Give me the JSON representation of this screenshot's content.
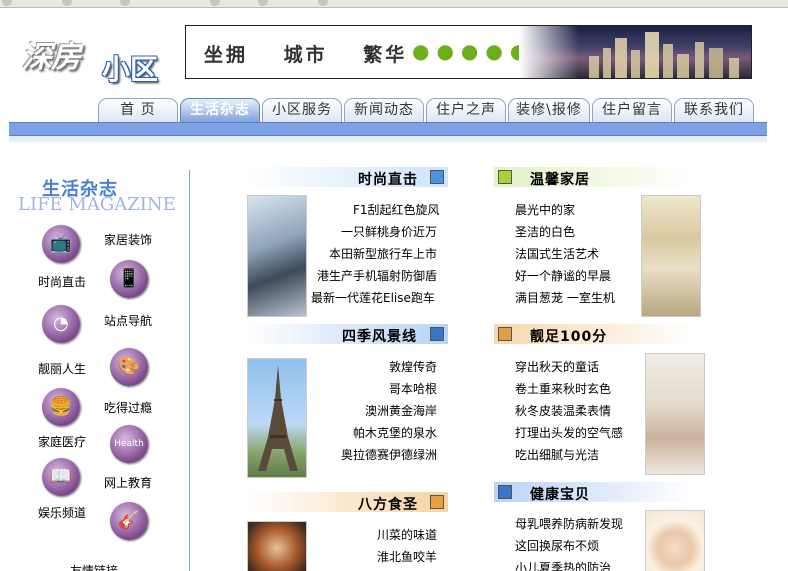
{
  "logo": {
    "part1": "深房",
    "part2": "小区"
  },
  "banner": {
    "slogan": [
      "坐拥",
      "城市",
      "繁华"
    ],
    "dots": "●●●●●"
  },
  "nav": {
    "tabs": [
      {
        "label": "首 页",
        "active": false
      },
      {
        "label": "生活杂志",
        "active": true
      },
      {
        "label": "小区服务",
        "active": false
      },
      {
        "label": "新闻动态",
        "active": false
      },
      {
        "label": "住户之声",
        "active": false
      },
      {
        "label": "装修\\报修",
        "active": false
      },
      {
        "label": "住户留言",
        "active": false
      },
      {
        "label": "联系我们",
        "active": false
      }
    ]
  },
  "sidebar": {
    "title": "生活杂志",
    "subtitle": "LIFE MAGAZINE",
    "items": [
      {
        "label": "家居装饰",
        "icon": "tv-icon"
      },
      {
        "label": "时尚直击",
        "icon": "mobile-phone-icon"
      },
      {
        "label": "站点导航",
        "icon": "clock-icon"
      },
      {
        "label": "靓丽人生",
        "icon": "palette-icon"
      },
      {
        "label": "吃得过瘾",
        "icon": "hamburger-icon"
      },
      {
        "label": "家庭医疗",
        "icon": "medicine-icon"
      },
      {
        "label": "网上教育",
        "icon": "book-icon"
      },
      {
        "label": "娱乐频道",
        "icon": "guitar-icon"
      }
    ],
    "bottom_label": "友情链接"
  },
  "sections": {
    "fashion": {
      "title": "时尚直击",
      "color": "#4b94e0",
      "items": [
        "F1刮起红色旋风",
        "一只鲜桃身价近万",
        "本田新型旅行车上市",
        "港生产手机辐射防御盾",
        "最新一代莲花Elise跑车"
      ]
    },
    "home": {
      "title": "温馨家居",
      "color": "#a6d23a",
      "items": [
        "晨光中的家",
        "圣洁的白色",
        "法国式生活艺术",
        "好一个静谧的早晨",
        "满目葱茏  一室生机"
      ]
    },
    "scenery": {
      "title": "四季风景线",
      "color": "#3a76c8",
      "items": [
        "敦煌传奇",
        "哥本哈根",
        "澳洲黄金海岸",
        "帕木克堡的泉水",
        "奥拉德赛伊德绿洲"
      ]
    },
    "beauty": {
      "title": "靓足100分",
      "color": "#e0a048",
      "items": [
        "穿出秋天的童话",
        "卷土重来秋时玄色",
        "秋冬皮装温柔表情",
        "打理出头发的空气感",
        "吃出细腻与光洁"
      ]
    },
    "food": {
      "title": "八方食圣",
      "color": "#e8a040",
      "items": [
        "川菜的味道",
        "淮北鱼咬羊"
      ]
    },
    "health": {
      "title": "健康宝贝",
      "color": "#3a76c8",
      "items": [
        "母乳喂养防病新发现",
        "这回换尿布不烦",
        "小儿夏季热的防治"
      ]
    }
  }
}
